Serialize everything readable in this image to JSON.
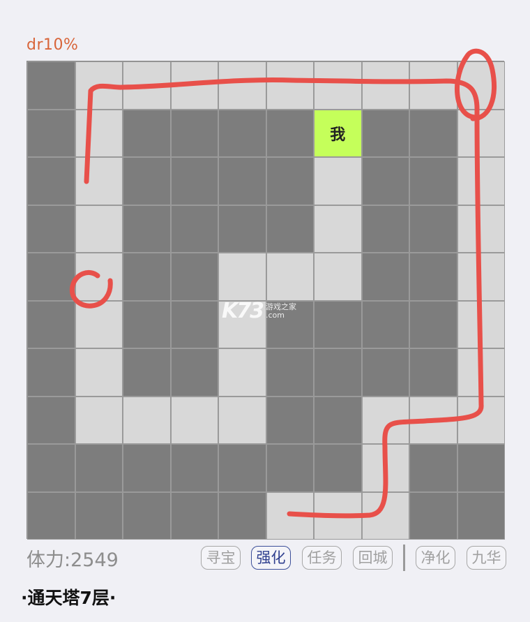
{
  "header": {
    "drop_rate": "dr10%"
  },
  "grid": {
    "rows": [
      [
        "wall",
        "path",
        "path",
        "path",
        "path",
        "path",
        "path",
        "path",
        "path",
        "path"
      ],
      [
        "wall",
        "path",
        "wall",
        "wall",
        "wall",
        "wall",
        "me",
        "wall",
        "wall",
        "path"
      ],
      [
        "wall",
        "path",
        "wall",
        "wall",
        "wall",
        "wall",
        "path",
        "wall",
        "wall",
        "path"
      ],
      [
        "wall",
        "path",
        "wall",
        "wall",
        "wall",
        "wall",
        "path",
        "wall",
        "wall",
        "path"
      ],
      [
        "wall",
        "path",
        "wall",
        "wall",
        "path",
        "path",
        "path",
        "wall",
        "wall",
        "path"
      ],
      [
        "wall",
        "path",
        "wall",
        "wall",
        "path",
        "wall",
        "wall",
        "wall",
        "wall",
        "path"
      ],
      [
        "wall",
        "path",
        "wall",
        "wall",
        "path",
        "wall",
        "wall",
        "wall",
        "wall",
        "path"
      ],
      [
        "wall",
        "path",
        "path",
        "path",
        "path",
        "wall",
        "wall",
        "path",
        "path",
        "path"
      ],
      [
        "wall",
        "wall",
        "wall",
        "wall",
        "wall",
        "wall",
        "wall",
        "path",
        "wall",
        "wall"
      ],
      [
        "wall",
        "wall",
        "wall",
        "wall",
        "wall",
        "path",
        "path",
        "path",
        "wall",
        "wall"
      ]
    ],
    "player_label": "我",
    "colors": {
      "wall": "#7d7d7d",
      "path": "#d8d8d8",
      "player": "#c5ff5a",
      "annotation": "#e8504a"
    }
  },
  "watermark": {
    "logo": "K73",
    "line1": "游戏之家",
    "line2": ".com"
  },
  "status": {
    "stamina": "体力:2549"
  },
  "actions": [
    {
      "key": "treasure",
      "label": "寻宝",
      "active": false
    },
    {
      "key": "enhance",
      "label": "强化",
      "active": true
    },
    {
      "key": "quest",
      "label": "任务",
      "active": false
    },
    {
      "key": "return",
      "label": "回城",
      "active": false
    },
    {
      "key": "purify",
      "label": "净化",
      "active": false
    },
    {
      "key": "jiuhua",
      "label": "九华",
      "active": false
    }
  ],
  "footer": {
    "floor_title": "·通天塔7层·"
  }
}
